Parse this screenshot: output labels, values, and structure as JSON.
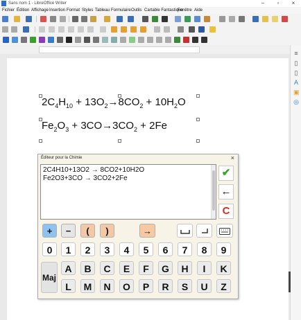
{
  "window": {
    "title": "Sans nom 1 - LibreOffice Writer",
    "minimize": "–",
    "maximize": "▫",
    "close": "×"
  },
  "menubar": [
    "Fichier",
    "Édition",
    "Affichage",
    "Insertion",
    "Format",
    "Styles",
    "Tableau",
    "Formulaire",
    "Outils",
    "Cartable Fantastique",
    "Fenêtre",
    "Aide"
  ],
  "document": {
    "formula1": {
      "parts": [
        "2C",
        "4",
        "H",
        "10",
        " + 13O",
        "2",
        "→8CO",
        "2",
        " + 10H",
        "2",
        "O"
      ]
    },
    "formula2": {
      "parts": [
        "Fe",
        "2",
        "O",
        "3",
        " + 3CO→3CO",
        "2",
        " + 2Fe"
      ]
    }
  },
  "dialog": {
    "title": "Éditeur pour la Chimie",
    "close": "×",
    "editor_lines": [
      "2C4H10+13O2 → 8CO2+10H2O",
      "Fe2O3+3CO → 3CO2+2Fe"
    ],
    "validate_label": "✔",
    "back_label": "←",
    "clear_label": "C",
    "operators": [
      "+",
      "−",
      "(",
      ")",
      "→"
    ],
    "digits": [
      "0",
      "1",
      "2",
      "3",
      "4",
      "5",
      "6",
      "7",
      "8",
      "9"
    ],
    "letters_row1": [
      "A",
      "B",
      "C",
      "E",
      "F",
      "G",
      "H",
      "I",
      "K"
    ],
    "letters_row2": [
      "L",
      "M",
      "N",
      "O",
      "P",
      "R",
      "S",
      "U",
      "Z"
    ],
    "maj_label": "Maj"
  },
  "colors": {
    "validate": "#3aa02b",
    "clear": "#e02a1c",
    "plus_key": "#8fc3ef",
    "minus_key": "#e6e6e6",
    "paren_key": "#f3c8a6",
    "arrow_key": "#f6c9a3",
    "dialog_bg": "#f7f3e6"
  }
}
